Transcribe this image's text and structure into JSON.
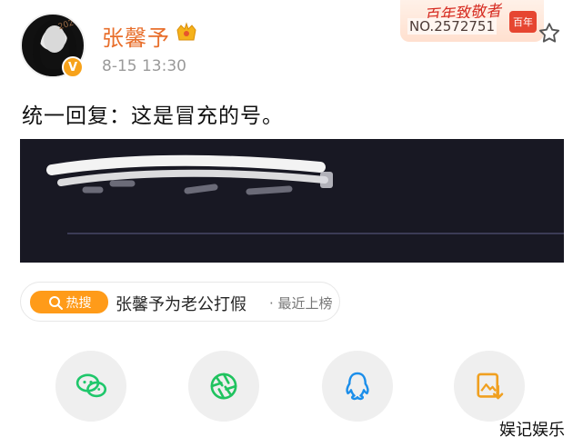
{
  "user": {
    "name": "张馨予",
    "time": "8-15 13:30",
    "avatar_tag": "2020",
    "verified": "V"
  },
  "badge": {
    "title": "百年致敬者",
    "number": "NO.2572751",
    "stamp_text": "百年"
  },
  "post": {
    "text": "统一回复：这是冒充的号。"
  },
  "hot_tag": {
    "label": "热搜",
    "topic": "张馨予为老公打假",
    "suffix": "· 最近上榜"
  },
  "share": [
    {
      "name": "wechat",
      "icon": "wechat-icon",
      "color": "#1fc76b"
    },
    {
      "name": "moments",
      "icon": "moments-icon",
      "color": "#20c35f"
    },
    {
      "name": "qq",
      "icon": "qq-icon",
      "color": "#1b8eea"
    },
    {
      "name": "save-image",
      "icon": "image-download-icon",
      "color": "#f0a020"
    }
  ],
  "watermark": "娱记娱乐"
}
